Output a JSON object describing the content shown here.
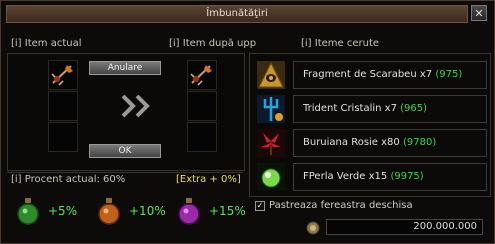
{
  "window": {
    "title": "Îmbunătăţiri",
    "close_label": "✕"
  },
  "headers": {
    "current_item": "[i] Item actual",
    "after_upgrade": "[i] Item după upp",
    "required_items": "[i] Iteme cerute"
  },
  "buttons": {
    "cancel": "Anulare",
    "ok": "OK"
  },
  "requirements": [
    {
      "name": "Fragment de Scarabeu x7",
      "count": "(975)",
      "icon": "scarab-fragment-icon",
      "color": "#c9962a"
    },
    {
      "name": "Trident Cristalin x7",
      "count": "(965)",
      "icon": "crystal-trident-icon",
      "color": "#2aa0e0"
    },
    {
      "name": "Buruiana Rosie x80",
      "count": "(9780)",
      "icon": "red-herb-icon",
      "color": "#d02030"
    },
    {
      "name": "FPerla Verde x15",
      "count": "(9975)",
      "icon": "green-pearl-icon",
      "color": "#7ad84a"
    }
  ],
  "percent": {
    "current_label": "[i] Procent actual: 60%",
    "extra_label": "[Extra + 0%]"
  },
  "potions": [
    {
      "bonus": "+5%",
      "icon": "green-potion-icon",
      "color": "#2f8a2a"
    },
    {
      "bonus": "+10%",
      "icon": "orange-potion-icon",
      "color": "#c0601a"
    },
    {
      "bonus": "+15%",
      "icon": "purple-potion-icon",
      "color": "#9a2aa8"
    }
  ],
  "keep_open": {
    "label": "Pastreaza fereastra deschisa",
    "checked": true,
    "check_glyph": "✓"
  },
  "money": {
    "amount": "200.000.000"
  }
}
